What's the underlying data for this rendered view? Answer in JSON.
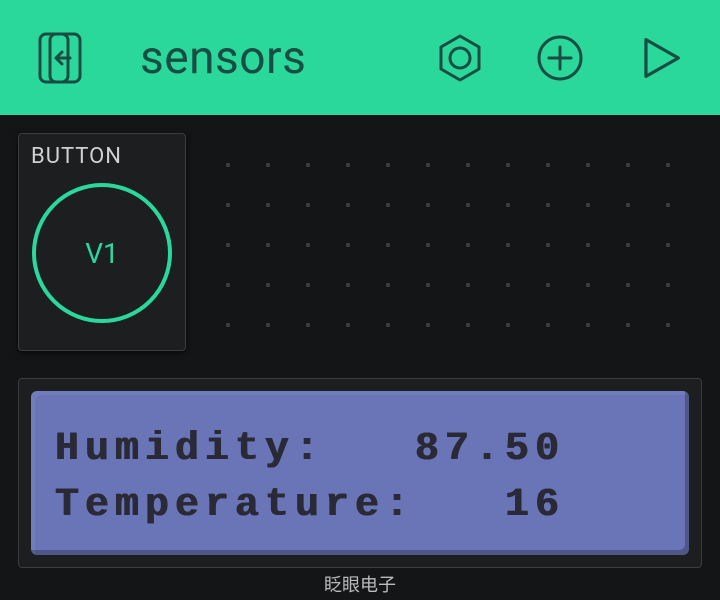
{
  "header": {
    "title": "sensors"
  },
  "widgets": {
    "button": {
      "title": "BUTTON",
      "pin": "V1"
    },
    "lcd": {
      "line1": "Humidity:   87.50",
      "line2": "Temperature:   16"
    }
  },
  "footer": {
    "brand": "眨眼电子"
  }
}
